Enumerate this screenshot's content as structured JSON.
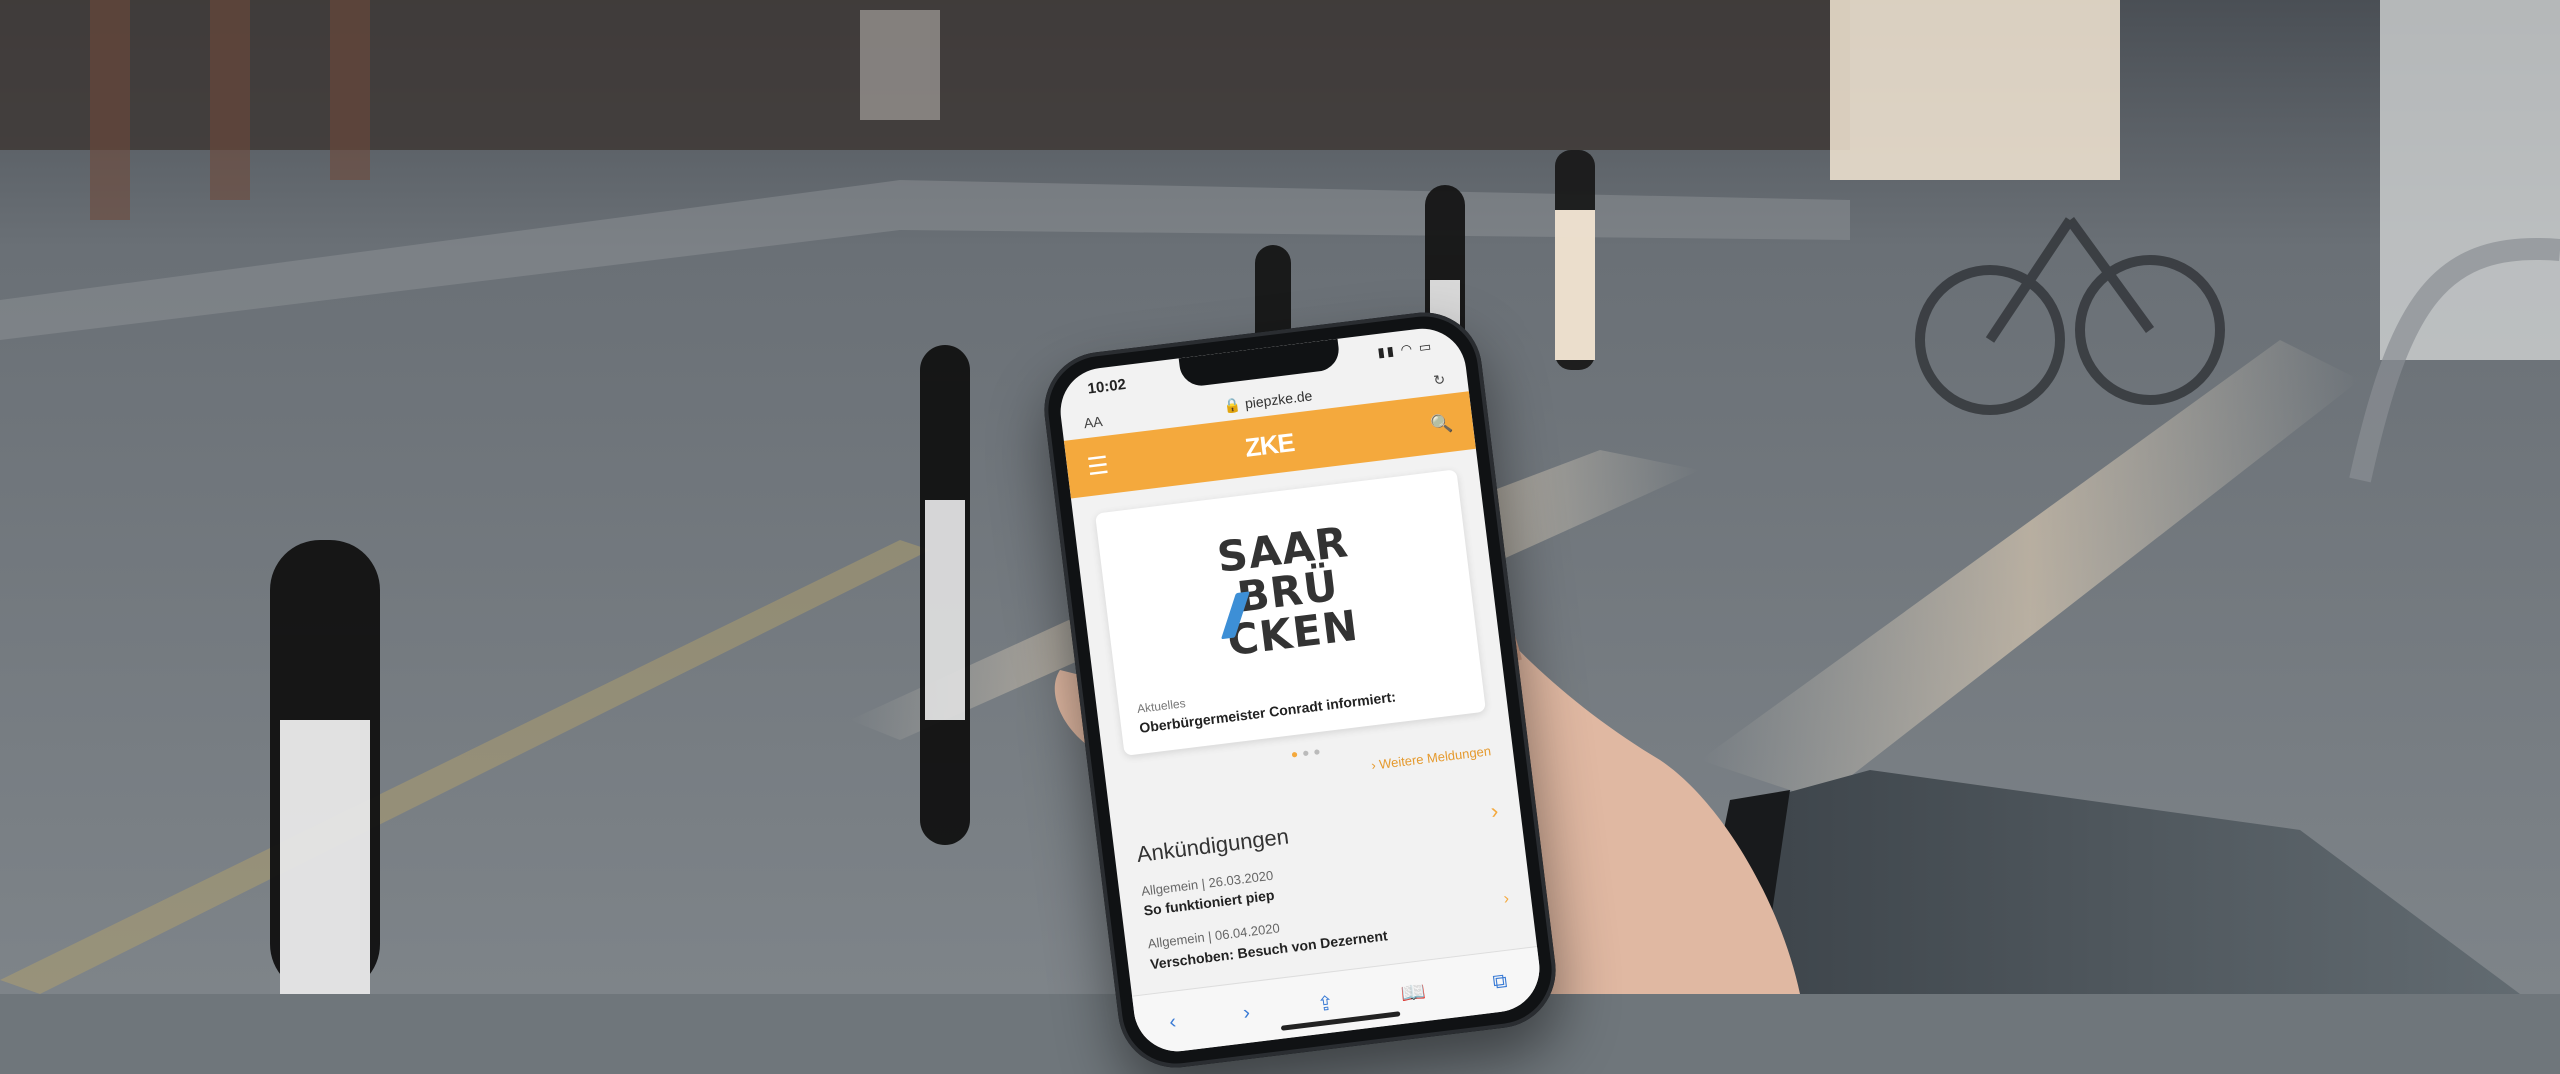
{
  "phone": {
    "status": {
      "time": "10:02",
      "icons": "▮▮ ◠ ▭"
    },
    "urlbar": {
      "left": "AA",
      "url": "🔒 piepzke.de",
      "reload": "↻"
    },
    "appbar": {
      "menu_icon": "☰",
      "logo": "ZKE",
      "search_icon": "🔍"
    },
    "brand_lines": [
      "SAAR",
      "BRÜ",
      "CKEN"
    ],
    "news": {
      "kicker": "Aktuelles",
      "headline": "Oberbürgermeister Conradt informiert:",
      "more": "› Weitere Meldungen"
    },
    "announcements": {
      "title": "Ankündigungen",
      "chevron": "›",
      "items": [
        {
          "meta": "Allgemein | 26.03.2020",
          "title": "So funktioniert piep"
        },
        {
          "meta": "Allgemein | 06.04.2020",
          "title": "Verschoben: Besuch von Dezernent"
        }
      ]
    },
    "toolbar": {
      "back": "‹",
      "forward": "›",
      "share": "⇪",
      "bookmarks": "📖",
      "tabs": "⧉"
    }
  },
  "colors": {
    "accent": "#f4a93d",
    "brand_blue": "#3d8fd6"
  }
}
